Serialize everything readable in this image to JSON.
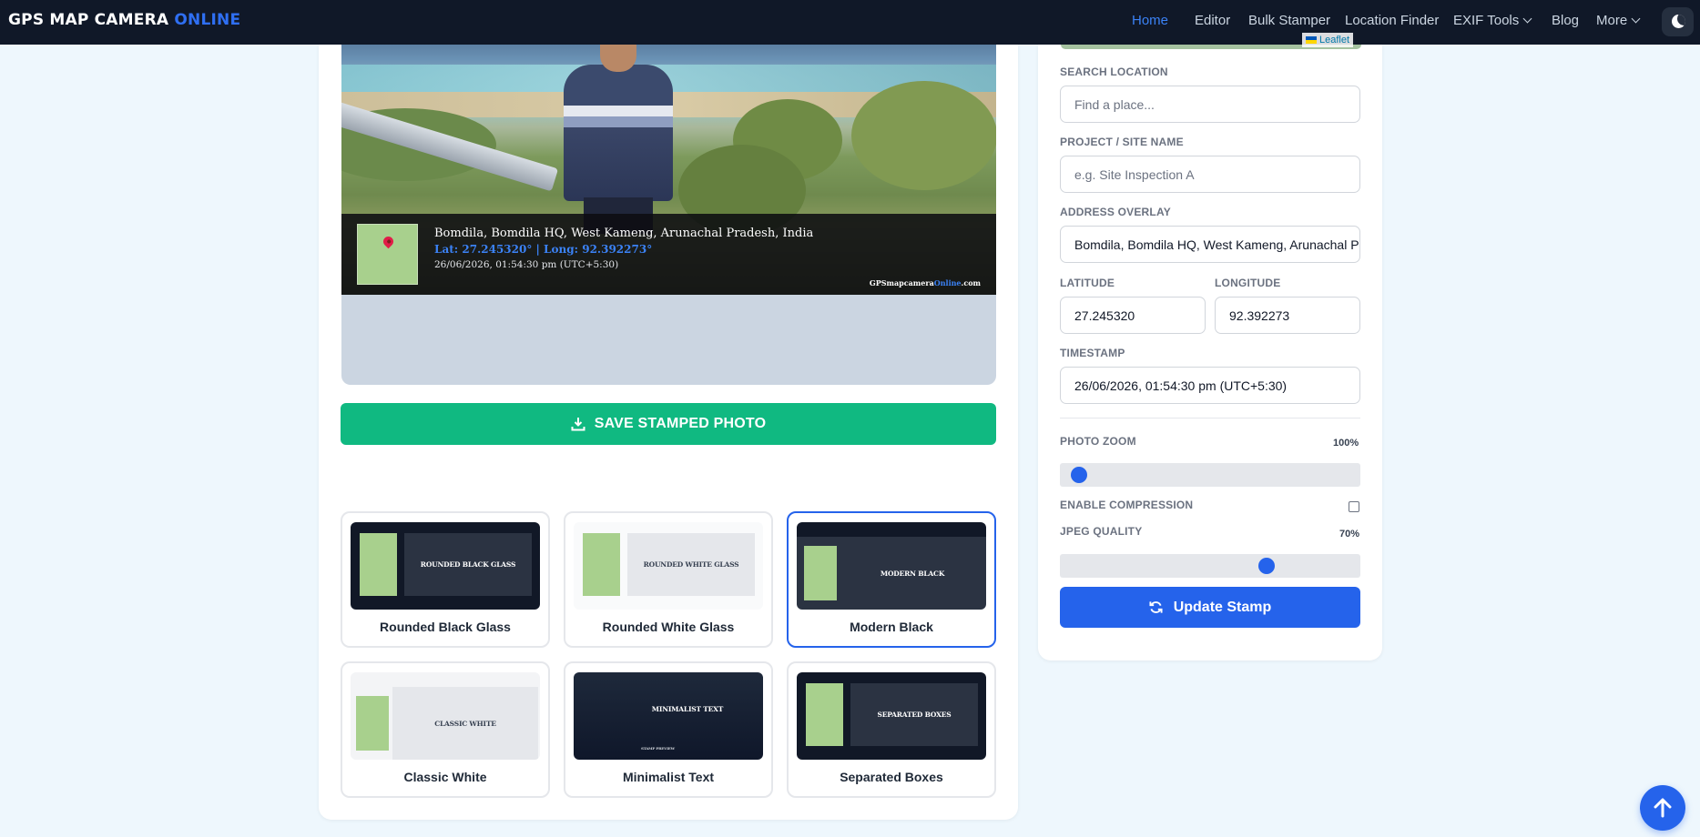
{
  "brand": {
    "name_main": "GPS MAP CAMERA",
    "name_accent": "ONLINE"
  },
  "nav": {
    "home": "Home",
    "editor": "Editor",
    "bulk_stamper": "Bulk Stamper",
    "location_finder": "Location Finder",
    "exif_tools": "EXIF Tools",
    "blog": "Blog",
    "more": "More"
  },
  "stamp": {
    "address": "Bomdila, Bomdila HQ, West Kameng, Arunachal Pradesh, India",
    "coords": "Lat: 27.245320° | Long: 92.392273°",
    "time": "26/06/2026, 01:54:30 pm (UTC+5:30)",
    "brand_a": "GPSmapcamera",
    "brand_b": "Online",
    "brand_c": ".com"
  },
  "save_button": "SAVE STAMPED PHOTO",
  "templates": [
    {
      "label": "Rounded Black Glass",
      "thumb_text": "ROUNDED BLACK GLASS"
    },
    {
      "label": "Rounded White Glass",
      "thumb_text": "ROUNDED WHITE GLASS"
    },
    {
      "label": "Modern Black",
      "thumb_text": "MODERN BLACK"
    },
    {
      "label": "Classic White",
      "thumb_text": "CLASSIC WHITE"
    },
    {
      "label": "Minimalist Text",
      "thumb_text": "MINIMALIST TEXT",
      "thumb_sub": "STAMP PREVIEW"
    },
    {
      "label": "Separated Boxes",
      "thumb_text": "SEPARATED BOXES"
    }
  ],
  "selected_template": "Modern Black",
  "map": {
    "attribution": "Leaflet"
  },
  "form": {
    "search_label": "SEARCH LOCATION",
    "search_placeholder": "Find a place...",
    "project_label": "PROJECT / SITE NAME",
    "project_placeholder": "e.g. Site Inspection A",
    "address_label": "ADDRESS OVERLAY",
    "address_value": "Bomdila, Bomdila HQ, West Kameng, Arunachal Pradesh, India",
    "latitude_label": "LATITUDE",
    "latitude_value": "27.245320",
    "longitude_label": "LONGITUDE",
    "longitude_value": "92.392273",
    "timestamp_label": "TIMESTAMP",
    "timestamp_value": "26/06/2026, 01:54:30 pm (UTC+5:30)",
    "zoom_label": "PHOTO ZOOM",
    "zoom_value": "100%",
    "zoom_fraction": 0.0,
    "compression_label": "ENABLE COMPRESSION",
    "compression_enabled": false,
    "quality_label": "JPEG QUALITY",
    "quality_value": "70%",
    "quality_fraction": 0.7,
    "update_button": "Update Stamp"
  },
  "colors": {
    "accent": "#2563eb",
    "save": "#10b981",
    "nav_bg": "#101828"
  },
  "icons": [
    "download-icon",
    "refresh-icon",
    "arrow-up-icon",
    "moon-icon",
    "chevron-down-icon"
  ]
}
